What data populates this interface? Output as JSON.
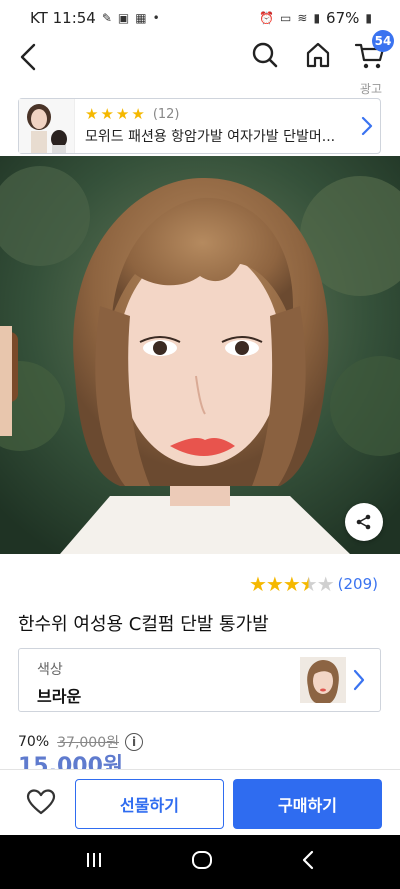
{
  "status_bar": {
    "carrier_time": "KT 11:54",
    "battery": "67%"
  },
  "nav": {
    "cart_count": "54"
  },
  "ad": {
    "label": "광고",
    "review_count": "(12)",
    "rating": 4,
    "title": "모위드 패션용 항암가발 여자가발 단발머..."
  },
  "product": {
    "rating": 3.5,
    "review_count": "(209)",
    "title": "한수위 여성용 C컬펌 단발 통가발"
  },
  "option": {
    "label": "색상",
    "value": "브라운"
  },
  "price": {
    "discount": "70%",
    "original": "37,000원",
    "info_symbol": "i",
    "sale": "15,000원"
  },
  "actions": {
    "gift_label": "선물하기",
    "buy_label": "구매하기"
  },
  "colors": {
    "accent": "#2f6cf0",
    "star": "#f5b800"
  }
}
